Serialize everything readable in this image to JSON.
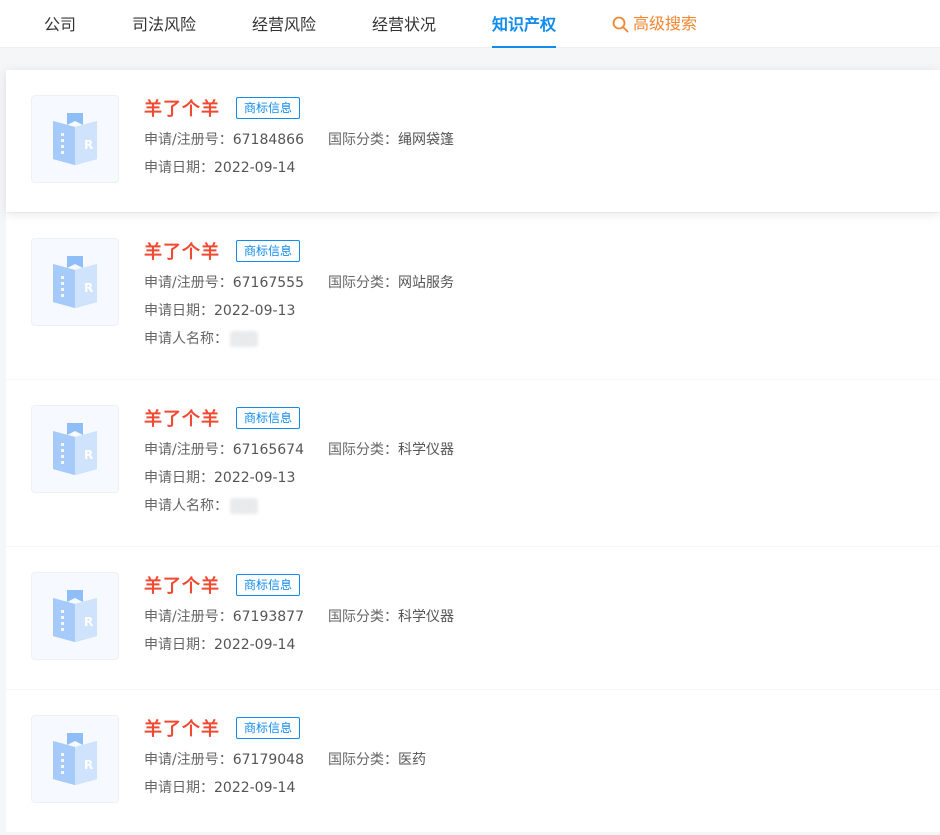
{
  "nav": {
    "tabs": [
      {
        "label": "公司"
      },
      {
        "label": "司法风险"
      },
      {
        "label": "经营风险"
      },
      {
        "label": "经营状况"
      },
      {
        "label": "知识产权"
      }
    ],
    "advanced_search": "高级搜索",
    "active_tab": "知识产权"
  },
  "labels": {
    "reg_no": "申请/注册号：",
    "intl_class": "国际分类：",
    "apply_date": "申请日期：",
    "applicant": "申请人名称："
  },
  "records": [
    {
      "name": "羊了个羊",
      "tag": "商标信息",
      "reg_no": "67184866",
      "intl_class": "绳网袋篷",
      "apply_date": "2022-09-14"
    },
    {
      "name": "羊了个羊",
      "tag": "商标信息",
      "reg_no": "67167555",
      "intl_class": "网站服务",
      "apply_date": "2022-09-13",
      "applicant_hidden": true
    },
    {
      "name": "羊了个羊",
      "tag": "商标信息",
      "reg_no": "67165674",
      "intl_class": "科学仪器",
      "apply_date": "2022-09-13",
      "applicant_hidden": true
    },
    {
      "name": "羊了个羊",
      "tag": "商标信息",
      "reg_no": "67193877",
      "intl_class": "科学仪器",
      "apply_date": "2022-09-14"
    },
    {
      "name": "羊了个羊",
      "tag": "商标信息",
      "reg_no": "67179048",
      "intl_class": "医药",
      "apply_date": "2022-09-14"
    }
  ],
  "colors": {
    "accent": "#128bed",
    "name_red": "#f04a33",
    "advanced_orange": "#ef8733"
  }
}
